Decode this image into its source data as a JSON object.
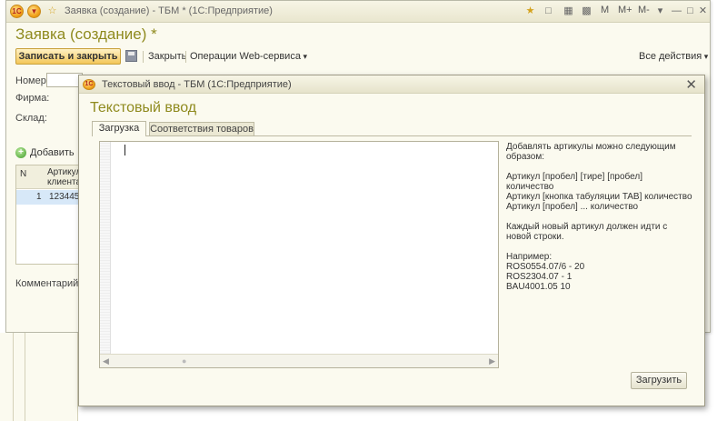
{
  "main": {
    "window_title": "Заявка (создание) - ТБМ * (1С:Предприятие)",
    "heading": "Заявка (создание) *",
    "toolbar": {
      "save_close": "Записать и закрыть",
      "close": "Закрыть",
      "webservice": "Операции Web-сервиса",
      "all_actions": "Все действия"
    },
    "titlebar_buttons": {
      "m": "M",
      "m_plus": "M+",
      "m_minus": "M-"
    },
    "fields": {
      "number": "Номер:",
      "firm": "Фирма:",
      "warehouse": "Склад:",
      "comment": "Комментарий:"
    },
    "table": {
      "add": "Добавить",
      "col_n": "N",
      "col_article": "Артикул клиента",
      "row_n": "1",
      "row_article": "123445"
    }
  },
  "dialog": {
    "window_title": "Текстовый ввод - ТБМ  (1С:Предприятие)",
    "heading": "Текстовый ввод",
    "tabs": [
      "Загрузка",
      "Соответствия товаров"
    ],
    "editor_value": "",
    "hint": {
      "line1": "Добавлять артикулы можно следующим образом:",
      "line2": "Артикул [пробел] [тире] [пробел] количество",
      "line3": "Артикул [кнопка табуляции TAB] количество",
      "line4": "Артикул [пробел] ... количество",
      "line5": "Каждый новый артикул должен идти с новой строки.",
      "line6": "Например:",
      "line7": "ROS0554.07/6 - 20",
      "line8": "ROS2304.07 - 1",
      "line9": "BAU4001.05 10"
    },
    "load_button": "Загрузить"
  }
}
